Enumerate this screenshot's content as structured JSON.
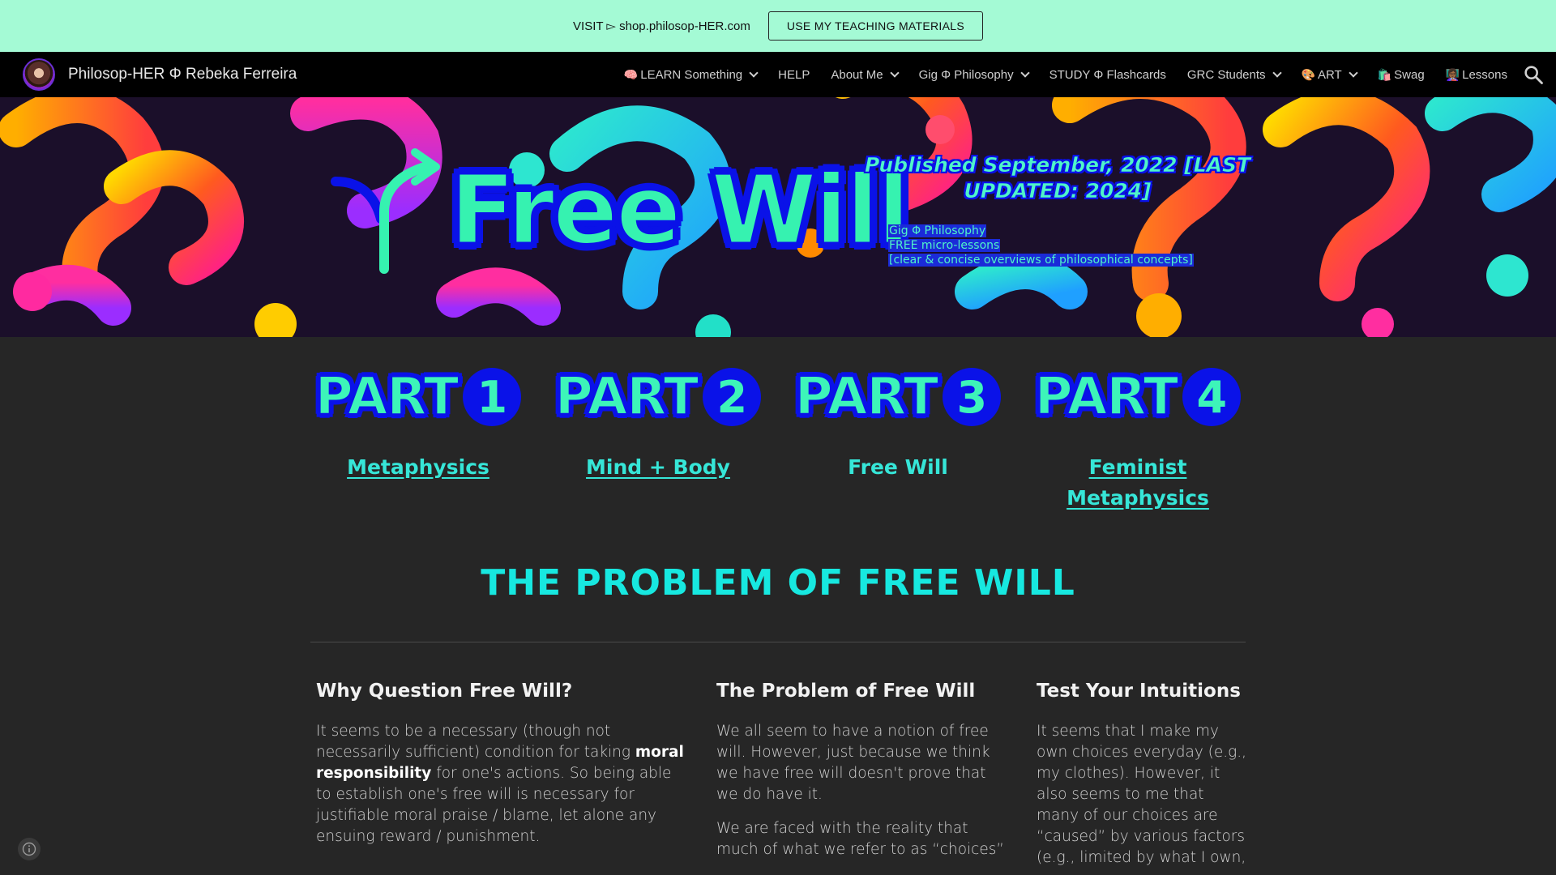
{
  "announce": {
    "text": "VISIT ▻ shop.philosop-HER.com",
    "button_label": "USE MY TEACHING MATERIALS"
  },
  "header": {
    "site_title": "Philosop-HER Φ Rebeka Ferreira",
    "nav": [
      {
        "emoji": "🧠",
        "label": "LEARN Something",
        "has_dropdown": true
      },
      {
        "emoji": "",
        "label": "HELP",
        "has_dropdown": false
      },
      {
        "emoji": "",
        "label": "About Me",
        "has_dropdown": true
      },
      {
        "emoji": "",
        "label": "Gig Φ Philosophy",
        "has_dropdown": true
      },
      {
        "emoji": "",
        "label": "STUDY Φ Flashcards",
        "has_dropdown": false
      },
      {
        "emoji": "",
        "label": "GRC Students",
        "has_dropdown": true
      },
      {
        "emoji": "🎨",
        "label": "ART",
        "has_dropdown": true
      },
      {
        "emoji": "🛍️",
        "label": "Swag",
        "has_dropdown": false
      },
      {
        "emoji": "👩🏾‍🏫",
        "label": "Lessons",
        "has_dropdown": false
      }
    ],
    "search_icon": "search-icon"
  },
  "hero": {
    "title": "Free Will",
    "published": "Published September, 2022 [LAST UPDATED: 2024]",
    "subtitle_lines": [
      "Gig Φ Philosophy",
      "FREE micro-lessons",
      "[clear & concise overviews of philosophical concepts]"
    ]
  },
  "parts": [
    {
      "word": "PART",
      "num": "1",
      "link": "Metaphysics",
      "is_link": true
    },
    {
      "word": "PART",
      "num": "2",
      "link": "Mind + Body",
      "is_link": true
    },
    {
      "word": "PART",
      "num": "3",
      "link": "Free Will",
      "is_link": false
    },
    {
      "word": "PART",
      "num": "4",
      "link": "Feminist Metaphysics",
      "is_link": true
    }
  ],
  "section": {
    "title": "THE PROBLEM OF FREE WILL"
  },
  "columns": [
    {
      "heading": "Why Question Free Will?",
      "p1_a": "It seems to be a necessary (though not necessarily sufficient) condition for taking ",
      "p1_bold": "moral responsibility",
      "p1_b": " for one's actions. So being able to establish one's free will is necessary for justifiable moral praise / blame, let alone any ensuing reward / punishment."
    },
    {
      "heading": "The Problem of Free Will",
      "p1": "We all seem to have a notion of free will. However, just because we think we have free will doesn't prove that we do have it.",
      "p2": "We are faced with the reality that much of what we refer to as “choices”"
    },
    {
      "heading": "Test Your Intuitions",
      "p1": "It seems that I make my own choices everyday (e.g., my clothes). However, it also seems to me that many of our choices are “caused” by various factors (e.g., limited by what I own,"
    }
  ],
  "colors": {
    "announce_bg": "#a4fad5",
    "page_bg": "#262626",
    "accent_teal": "#17e8e0",
    "hero_green": "#36f2b0",
    "hero_blue": "#0a12e8"
  }
}
